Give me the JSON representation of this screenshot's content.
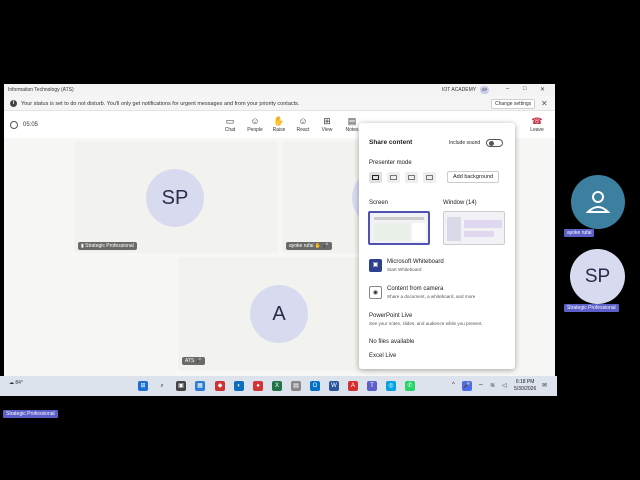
{
  "window": {
    "title": "Information Technology (ATS)",
    "org": "IOT ACADEMY",
    "user_initials": "SP"
  },
  "banner": {
    "message": "Your status is set to do not disturb. You'll only get notifications for urgent messages and from your priority contacts.",
    "change_settings": "Change settings"
  },
  "toolbar": {
    "timer": "05:05",
    "items": [
      {
        "label": "Chat",
        "icon": "chat-icon"
      },
      {
        "label": "People",
        "icon": "people-icon"
      },
      {
        "label": "Raise",
        "icon": "raise-hand-icon"
      },
      {
        "label": "React",
        "icon": "react-icon"
      },
      {
        "label": "View",
        "icon": "view-icon"
      },
      {
        "label": "Notes",
        "icon": "notes-icon"
      }
    ],
    "leave": "Leave",
    "colors": {
      "leave": "#c4314b"
    }
  },
  "participants": [
    {
      "initials": "SP",
      "name": "Strategic Professional"
    },
    {
      "initials": "",
      "name": "ayoke rufai"
    },
    {
      "initials": "A",
      "name": "ATS"
    }
  ],
  "share_panel": {
    "title": "Share content",
    "include_sound": "Include sound",
    "presenter_mode": "Presenter mode",
    "add_background": "Add background",
    "screen": "Screen",
    "window": "Window (14)",
    "options": [
      {
        "title": "Microsoft Whiteboard",
        "subtitle": "Start Whiteboard"
      },
      {
        "title": "Content from camera",
        "subtitle": "Share a document, a whiteboard, and more"
      }
    ],
    "powerpoint_live": "PowerPoint Live",
    "powerpoint_sub": "See your notes, slides, and audience while you present.",
    "no_files": "No files available",
    "excel_live": "Excel Live"
  },
  "taskbar": {
    "temperature": "84°",
    "time": "6:18 PM",
    "date": "5/30/2026"
  },
  "side_panel": [
    {
      "initials": "",
      "name": "ayoke rufai"
    },
    {
      "initials": "SP",
      "name": "Strategic Professional"
    }
  ],
  "bottom_label": "Strategic Professional",
  "colors": {
    "accent": "#5b5fc7",
    "avatar_fill": "#d8daf0",
    "dark_avatar": "#3d7f9e"
  }
}
